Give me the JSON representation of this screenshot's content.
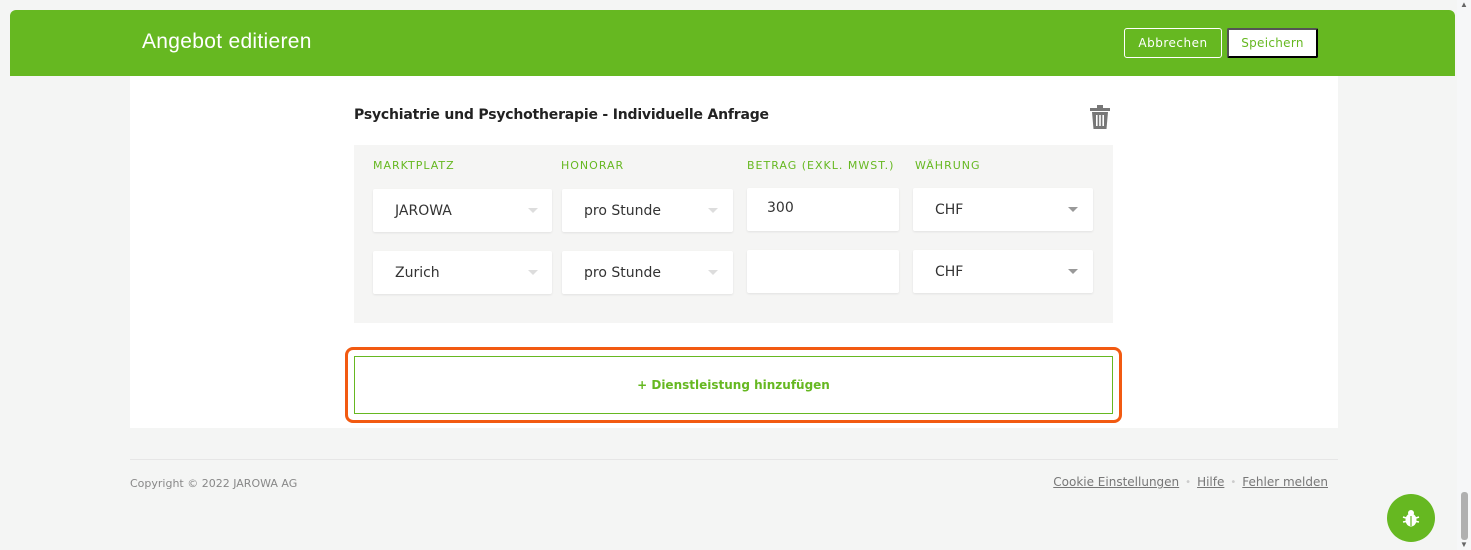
{
  "header": {
    "title": "Angebot editieren",
    "cancel_label": "Abbrechen",
    "save_label": "Speichern"
  },
  "service": {
    "title": "Psychiatrie und Psychotherapie - Individuelle Anfrage",
    "columns": [
      "MARKTPLATZ",
      "HONORAR",
      "BETRAG (EXKL. MWST.)",
      "WÄHRUNG"
    ],
    "rows": [
      {
        "marketplace": "JAROWA",
        "fee_type": "pro Stunde",
        "amount": "300",
        "currency": "CHF"
      },
      {
        "marketplace": "Zurich",
        "fee_type": "pro Stunde",
        "amount": "",
        "currency": "CHF"
      }
    ]
  },
  "add_service_label": "+ Dienstleistung hinzufügen",
  "footer": {
    "copyright": "Copyright © 2022 JAROWA AG",
    "links": [
      "Cookie Einstellungen",
      "Hilfe",
      "Fehler melden"
    ]
  },
  "icons": {
    "trash": "trash-icon",
    "bug": "bug-icon"
  },
  "colors": {
    "brand_green": "#66b821",
    "highlight_orange": "#f25a11"
  }
}
